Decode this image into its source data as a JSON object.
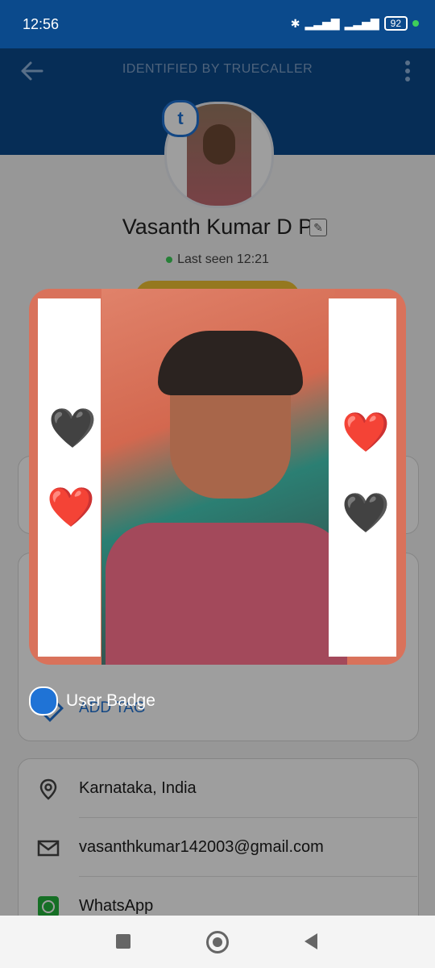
{
  "status_bar": {
    "time": "12:56",
    "battery": "92"
  },
  "header": {
    "title": "IDENTIFIED BY TRUECALLER"
  },
  "profile": {
    "badge_letter": "t",
    "name": "Vasanth Kumar D P",
    "last_seen": "Last seen 12:21"
  },
  "photo_viewer": {
    "badge_label": "User Badge"
  },
  "tags": {
    "add_tag_label": "ADD TAG"
  },
  "details": [
    {
      "icon": "location-pin-icon",
      "text": "Karnataka, India"
    },
    {
      "icon": "mail-icon",
      "text": "vasanthkumar142003@gmail.com"
    },
    {
      "icon": "whatsapp-icon",
      "text": "WhatsApp"
    }
  ],
  "colors": {
    "header_bg": "#0b4a8c",
    "accent": "#1f73d6",
    "online_dot": "#3ecf5a",
    "whatsapp": "#25b33d"
  },
  "emojis": {
    "black_heart": "🖤",
    "red_heart": "❤️"
  }
}
